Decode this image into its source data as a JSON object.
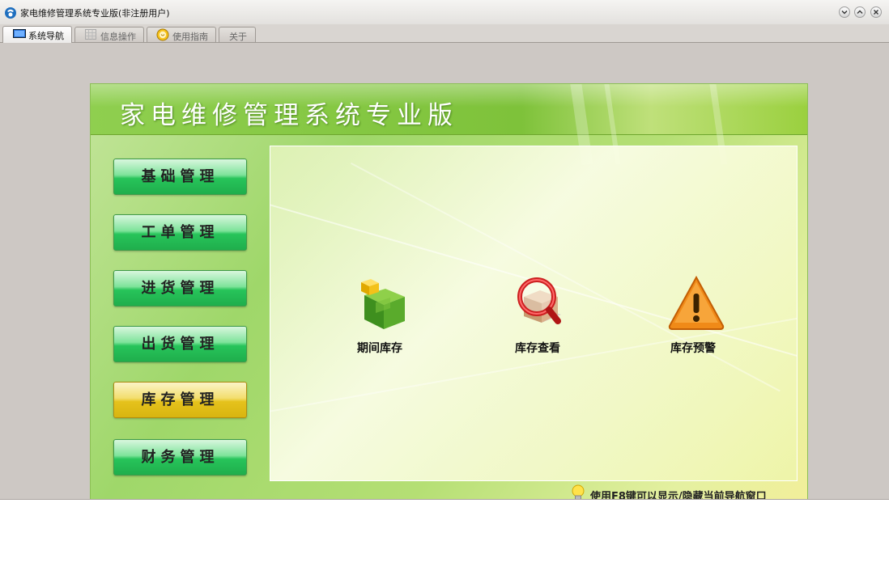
{
  "window": {
    "title": "家电维修管理系统专业版(非注册用户)"
  },
  "tabs": [
    {
      "label": "系统导航",
      "icon": "monitor-icon",
      "active": true
    },
    {
      "label": "信息操作",
      "icon": "grid-icon",
      "active": false
    },
    {
      "label": "使用指南",
      "icon": "smiley-icon",
      "active": false
    },
    {
      "label": "关于",
      "icon": "",
      "active": false
    }
  ],
  "nav_panel": {
    "title": "家电维修管理系统专业版"
  },
  "menu": [
    {
      "label": "基础管理"
    },
    {
      "label": "工单管理"
    },
    {
      "label": "进货管理"
    },
    {
      "label": "出货管理"
    },
    {
      "label": "库存管理",
      "active": true
    },
    {
      "label": "财务管理"
    }
  ],
  "modules": [
    {
      "label": "期间库存",
      "icon": "green-box-icon"
    },
    {
      "label": "库存查看",
      "icon": "magnifier-box-icon"
    },
    {
      "label": "库存预警",
      "icon": "warning-triangle-icon"
    }
  ],
  "hint": {
    "text": "使用F8键可以显示/隐藏当前导航窗口",
    "icon": "lightbulb-icon"
  },
  "colors": {
    "menu_normal": "#1fae4c",
    "menu_active": "#e5c21c",
    "panel_green": "#9fd76a"
  }
}
